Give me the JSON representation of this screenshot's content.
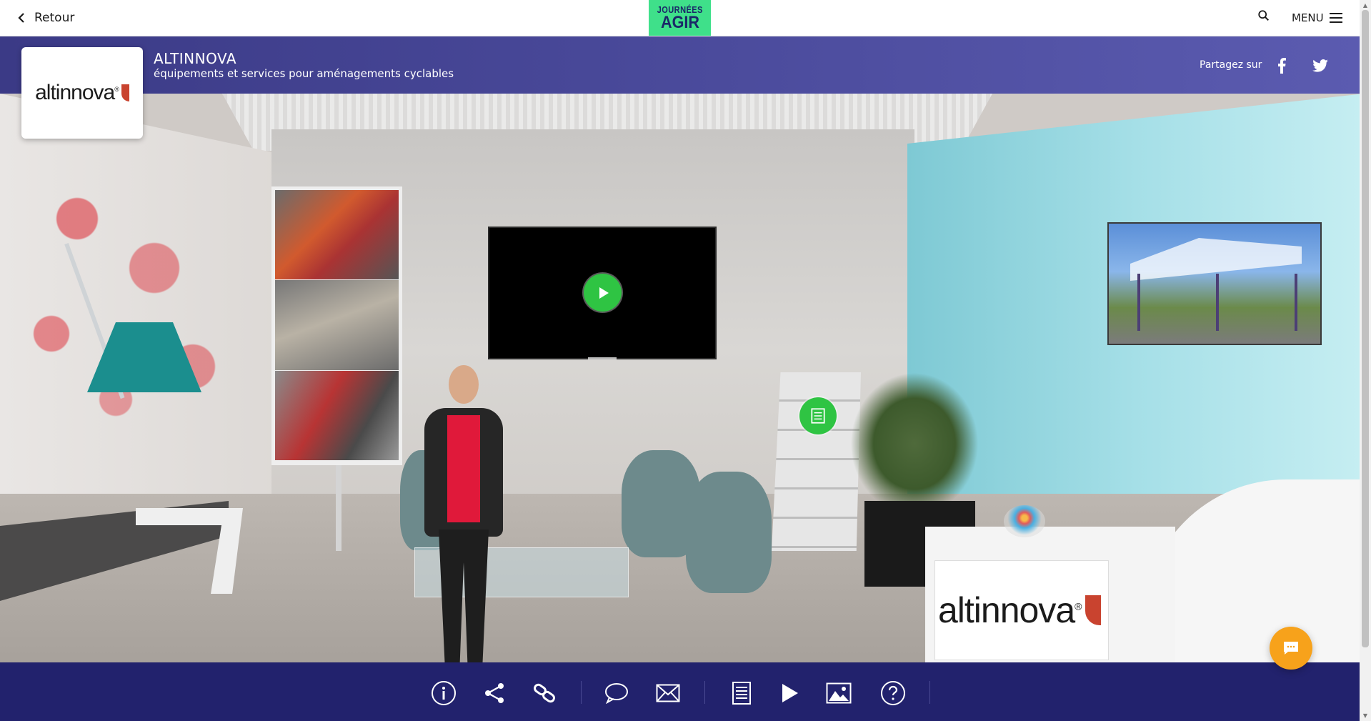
{
  "topbar": {
    "back_label": "Retour",
    "brand_line1": "JOURNÉES",
    "brand_line2": "AGIR",
    "menu_label": "MENU"
  },
  "exhibitor": {
    "logo_text": "altinnova",
    "logo_mark": "®",
    "name": "ALTINNOVA",
    "description": "équipements et services pour aménagements cyclables",
    "share_label": "Partagez sur"
  },
  "desk": {
    "logo_text": "altinnova",
    "logo_mark": "®"
  },
  "colors": {
    "accent_green": "#2fc443",
    "band_purple": "#3b3a86",
    "toolbar_navy": "#22226d",
    "chat_orange": "#f7a21b",
    "brand_green": "#3fe08a"
  },
  "toolbar": {
    "tools": [
      {
        "icon": "info-icon"
      },
      {
        "icon": "share-icon"
      },
      {
        "icon": "link-icon"
      },
      {
        "icon": "chat-bubble-icon"
      },
      {
        "icon": "mail-icon"
      },
      {
        "icon": "document-icon"
      },
      {
        "icon": "play-icon"
      },
      {
        "icon": "image-icon"
      },
      {
        "icon": "help-icon"
      }
    ]
  }
}
